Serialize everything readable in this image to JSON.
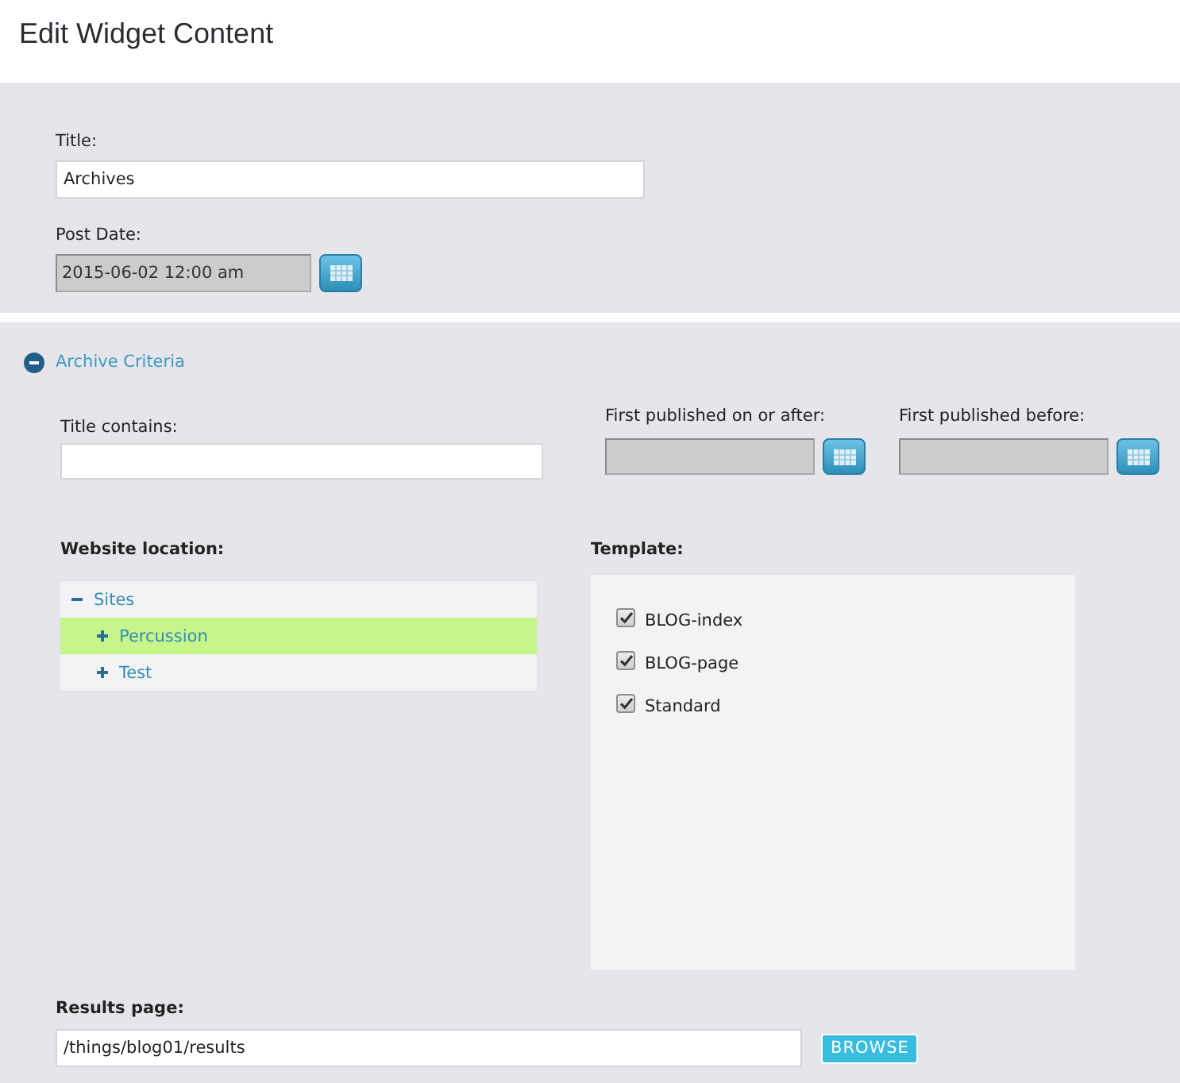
{
  "header": {
    "title": "Edit Widget Content"
  },
  "general": {
    "title": {
      "label": "Title:",
      "value": "Archives"
    },
    "post_date": {
      "label": "Post Date:",
      "value": "2015-06-02 12:00 am"
    }
  },
  "archive_criteria": {
    "label": "Archive Criteria",
    "expanded": true,
    "title_contains": {
      "label": "Title contains:"
    },
    "published_after": {
      "label": "First published on or after:"
    },
    "published_before": {
      "label": "First published before:"
    },
    "website_location": {
      "label": "Website location:",
      "tree": [
        {
          "label": "Sites",
          "expanded": true,
          "selected": false,
          "children": [
            {
              "label": "Percussion",
              "expanded": false,
              "selected": true
            },
            {
              "label": "Test",
              "expanded": false,
              "selected": false
            }
          ]
        }
      ]
    },
    "template": {
      "label": "Template:",
      "options": [
        {
          "label": "BLOG-index",
          "checked": true
        },
        {
          "label": "BLOG-page",
          "checked": true
        },
        {
          "label": "Standard",
          "checked": true
        }
      ]
    }
  },
  "results_page": {
    "label": "Results page:",
    "value": "/things/blog01/results",
    "button": "BROWSE"
  }
}
